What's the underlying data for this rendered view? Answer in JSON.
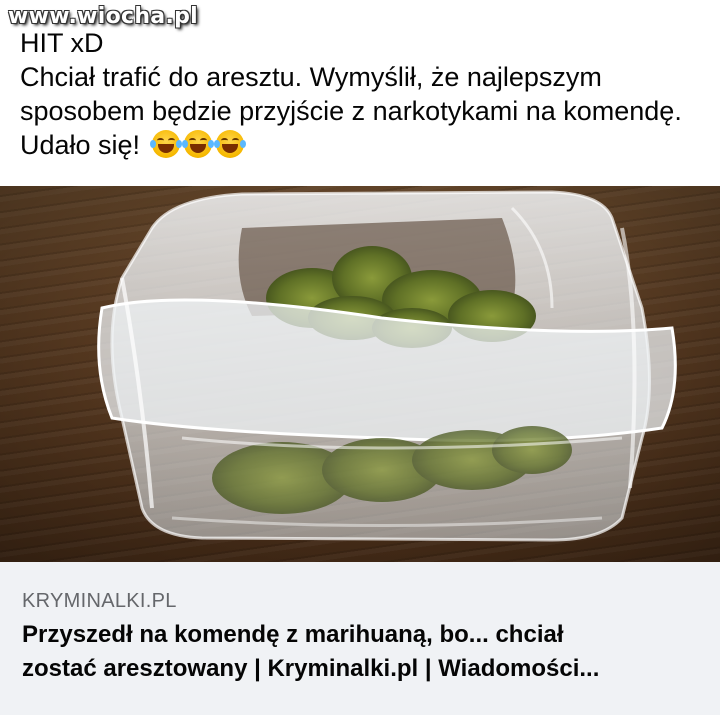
{
  "watermark": "www.wiocha.pl",
  "post": {
    "lines": [
      "HIT xD",
      "Chciał trafić do aresztu. Wymyślił, że najlepszym",
      "sposobem będzie przyjście z narkotykami na komendę.",
      "Udało się!"
    ],
    "emoji_icon": "face-with-tears-of-joy-icon",
    "emoji_count": 3
  },
  "link_preview": {
    "domain": "KRYMINALKI.PL",
    "title_lines": [
      "Przyszedł na komendę z marihuaną, bo... chciał",
      "zostać aresztowany | Kryminalki.pl | Wiadomości..."
    ]
  }
}
